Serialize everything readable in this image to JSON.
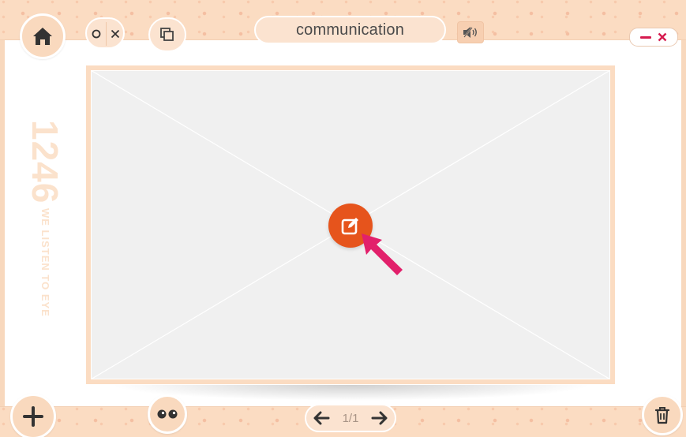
{
  "window": {
    "title": "communication"
  },
  "toolbar": {
    "close_toggle_label": "o×",
    "sound_state": "muted"
  },
  "brand": {
    "number": "1246",
    "tagline": "WE LISTEN TO EYE"
  },
  "pagination": {
    "current": "1/1"
  },
  "colors": {
    "bar": "#fbdcc2",
    "accent": "#e6541c",
    "cursor": "#e2206b",
    "close": "#d61b4f"
  },
  "icons": {
    "home": "home-icon",
    "copy": "copy-icon",
    "sound": "speaker-muted-icon",
    "edit": "edit-icon",
    "add": "plus-icon",
    "eyes": "eyes-icon",
    "trash": "trash-icon"
  }
}
